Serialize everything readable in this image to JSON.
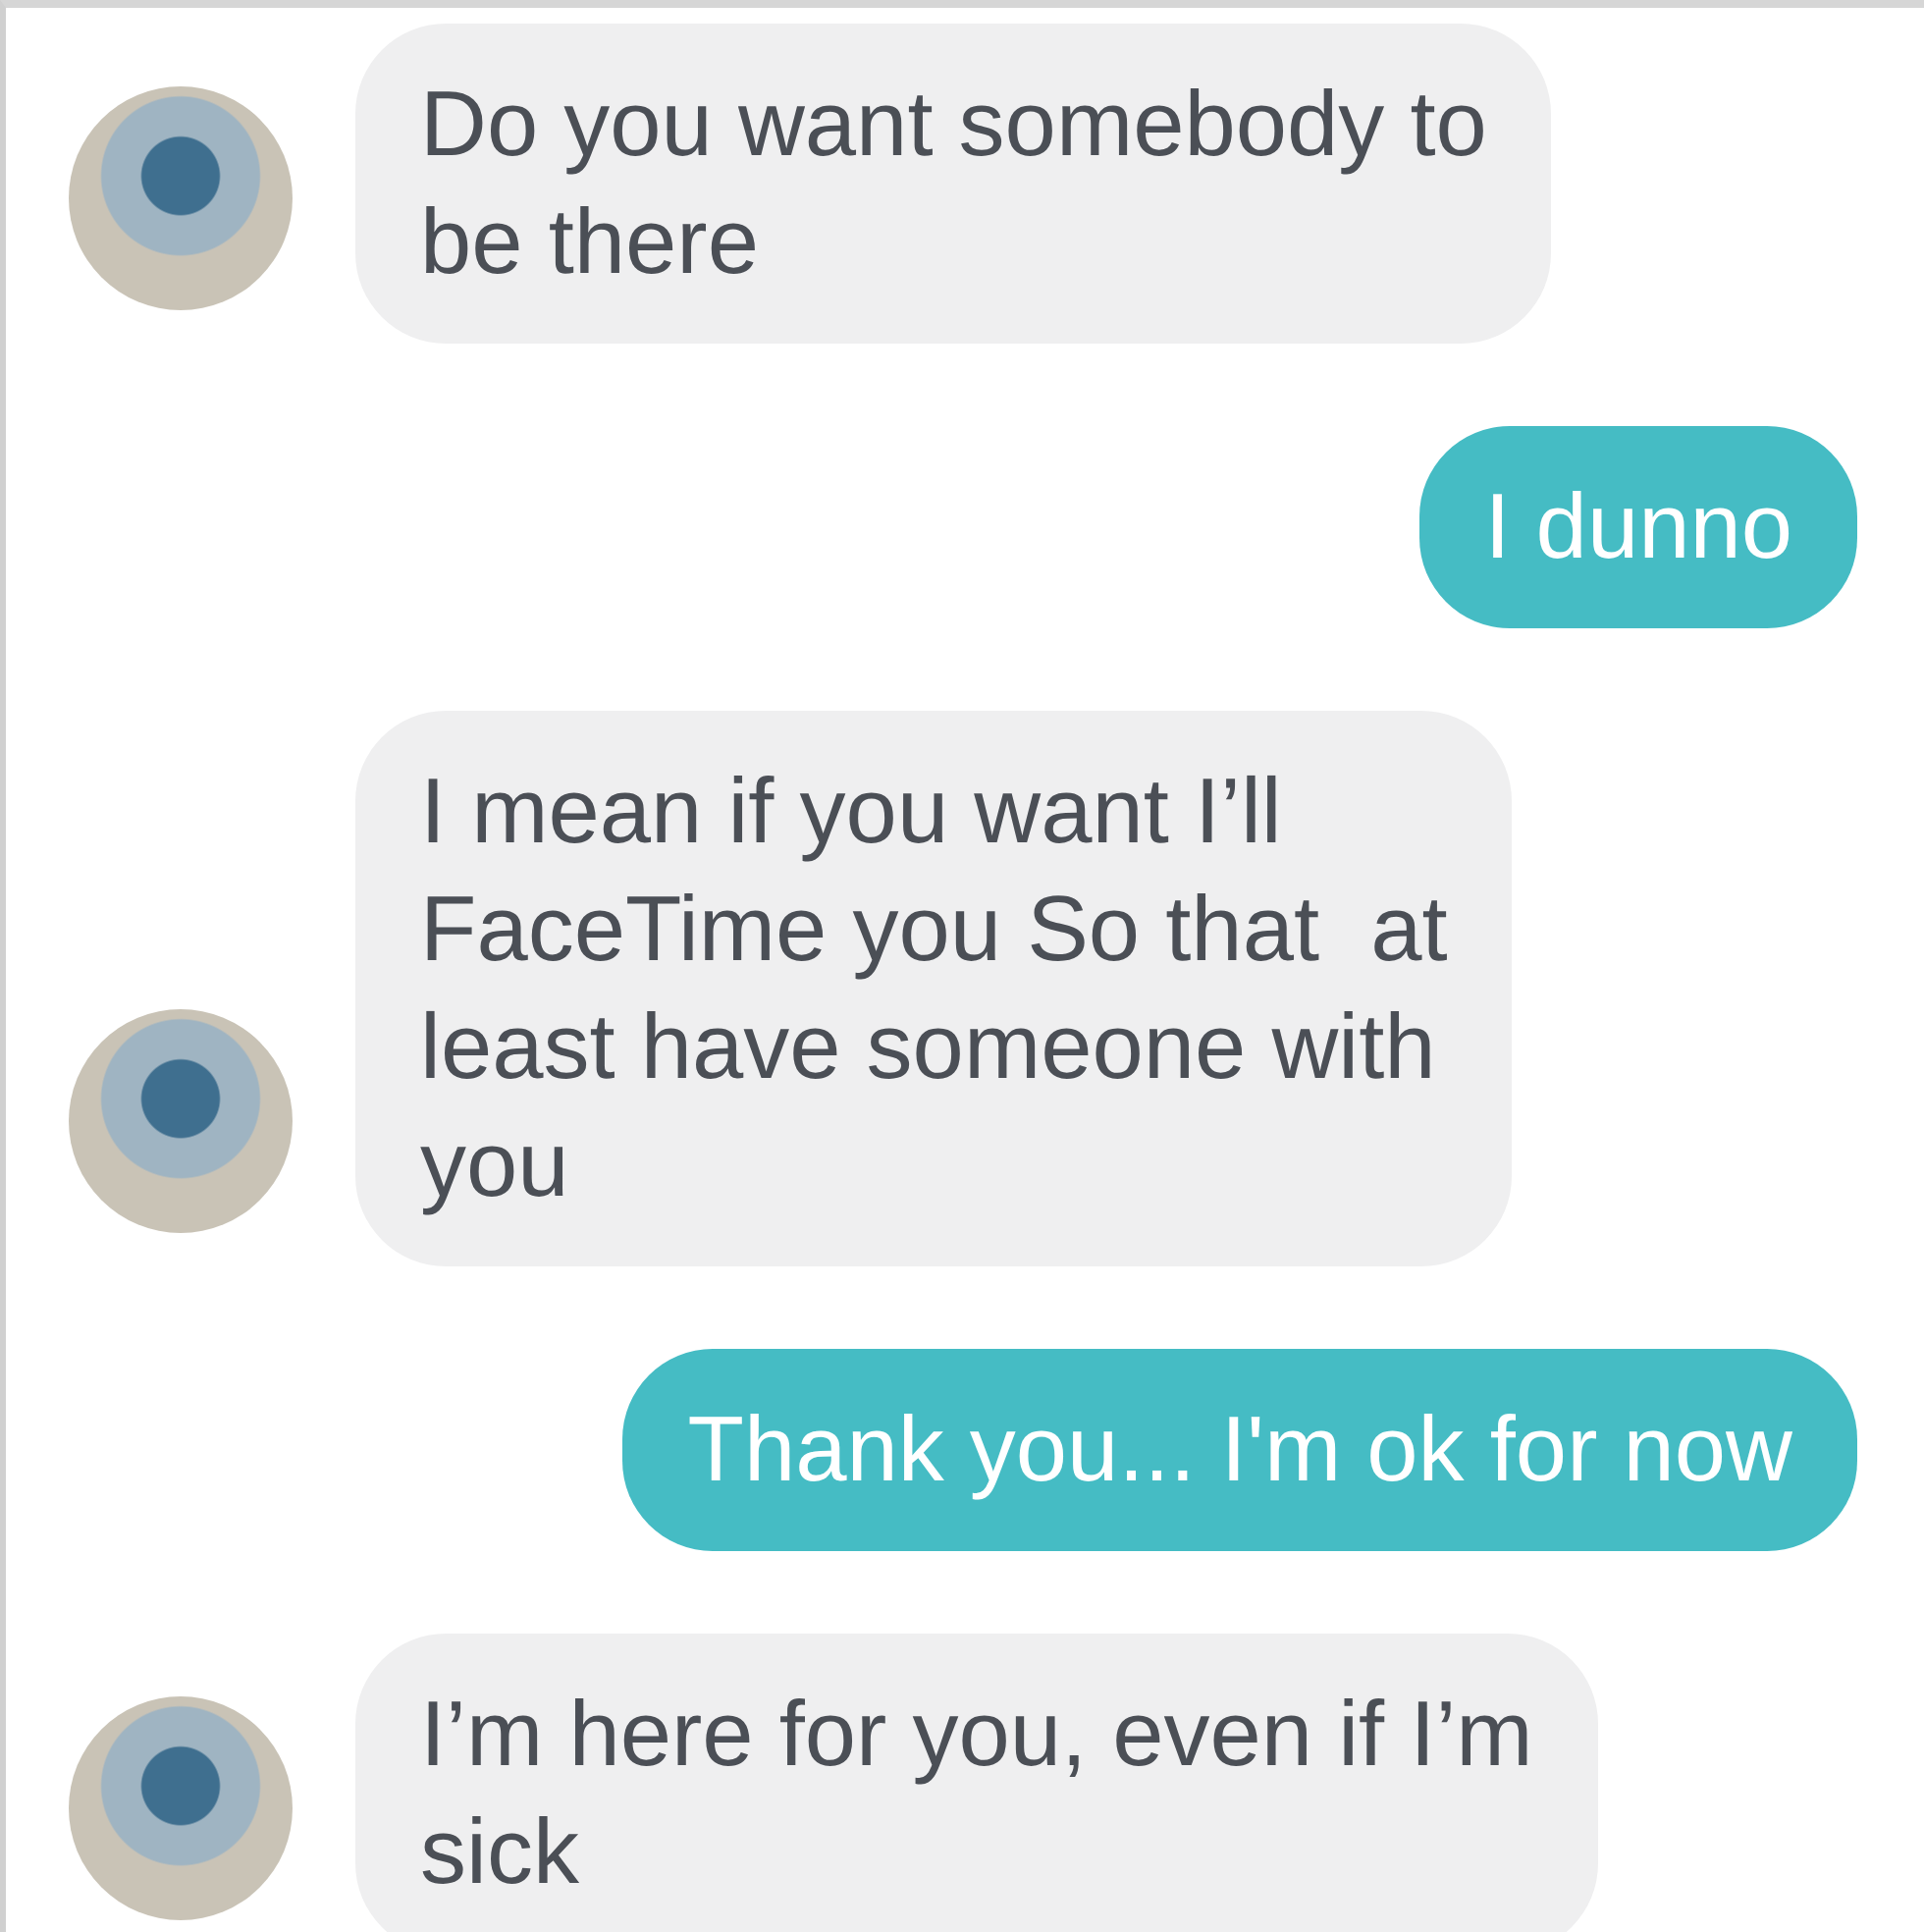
{
  "messages": [
    {
      "kind": "received",
      "lines": [
        "Do you want somebody to",
        "be there"
      ],
      "avatar": true
    },
    {
      "kind": "sent",
      "lines": [
        "I dunno"
      ],
      "avatar": false
    },
    {
      "kind": "received",
      "lines": [
        "I mean if you want I’ll",
        "FaceTime you So that  at",
        "least have someone with",
        "you"
      ],
      "avatar": true
    },
    {
      "kind": "sent",
      "lines": [
        "Thank you... I'm ok for now"
      ],
      "avatar": false
    },
    {
      "kind": "received",
      "lines": [
        "I’m here for you, even if I’m",
        "sick"
      ],
      "avatar": true
    }
  ]
}
